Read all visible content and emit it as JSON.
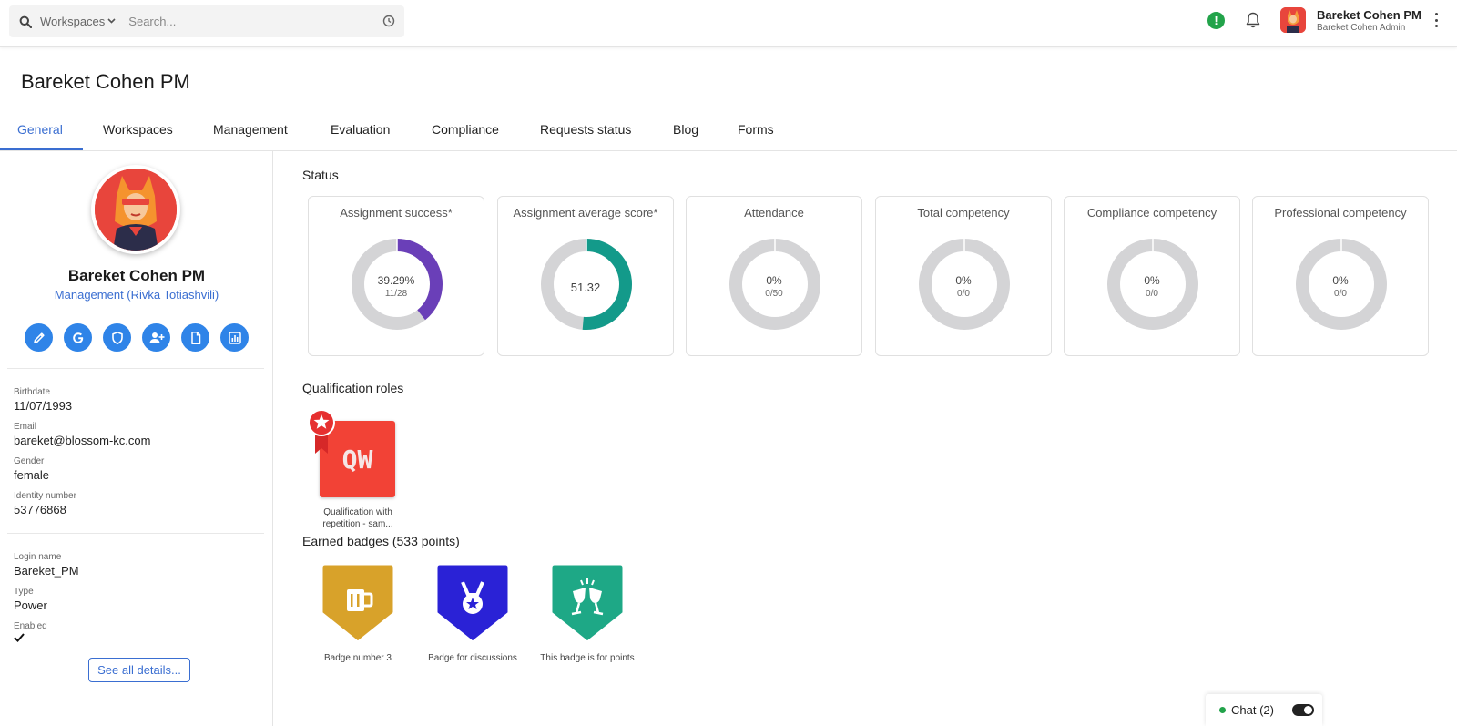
{
  "header": {
    "workspaces_label": "Workspaces",
    "search_placeholder": "Search...",
    "user_name": "Bareket Cohen PM",
    "user_role": "Bareket Cohen Admin",
    "alert_glyph": "!"
  },
  "page": {
    "title": "Bareket Cohen PM"
  },
  "tabs": [
    {
      "label": "General",
      "active": true
    },
    {
      "label": "Workspaces"
    },
    {
      "label": "Management"
    },
    {
      "label": "Evaluation"
    },
    {
      "label": "Compliance"
    },
    {
      "label": "Requests status"
    },
    {
      "label": "Blog"
    },
    {
      "label": "Forms"
    }
  ],
  "profile": {
    "name": "Bareket Cohen PM",
    "department": "Management (Rivka Totiashvili)",
    "actions": [
      "edit-icon",
      "google-icon",
      "shield-icon",
      "add-user-icon",
      "document-icon",
      "report-chart-icon"
    ],
    "fields": [
      {
        "label": "Birthdate",
        "value": "11/07/1993"
      },
      {
        "label": "Email",
        "value": "bareket@blossom-kc.com"
      },
      {
        "label": "Gender",
        "value": "female"
      },
      {
        "label": "Identity number",
        "value": "53776868"
      },
      {
        "label": "Login name",
        "value": "Bareket_PM"
      },
      {
        "label": "Type",
        "value": "Power"
      },
      {
        "label": "Enabled",
        "value": ""
      }
    ],
    "enabled": true,
    "see_all_label": "See all details..."
  },
  "status": {
    "title": "Status",
    "cards": [
      {
        "title": "Assignment success*",
        "percent": "39.29%",
        "fraction": "11/28",
        "fill": 0.3929,
        "color": "#6a3fb8"
      },
      {
        "title": "Assignment average score*",
        "percent": "51.32",
        "fraction": "",
        "fill": 0.5132,
        "color": "#139a8a"
      },
      {
        "title": "Attendance",
        "percent": "0%",
        "fraction": "0/50",
        "fill": 0,
        "color": "#999999"
      },
      {
        "title": "Total competency",
        "percent": "0%",
        "fraction": "0/0",
        "fill": 0,
        "color": "#999999"
      },
      {
        "title": "Compliance competency",
        "percent": "0%",
        "fraction": "0/0",
        "fill": 0,
        "color": "#999999"
      },
      {
        "title": "Professional competency",
        "percent": "0%",
        "fraction": "0/0",
        "fill": 0,
        "color": "#999999"
      }
    ]
  },
  "qualification": {
    "title": "Qualification roles",
    "items": [
      {
        "abbr": "QW",
        "label": "Qualification with repetition - sam...",
        "color": "#f24236"
      }
    ]
  },
  "badges": {
    "title": "Earned badges (533 points)",
    "items": [
      {
        "label": "Badge number 3",
        "color": "#d8a22a",
        "icon": "beer-mug-icon"
      },
      {
        "label": "Badge for discussions",
        "color": "#2a22d6",
        "icon": "medal-icon"
      },
      {
        "label": "This badge is for points",
        "color": "#1ea886",
        "icon": "cheers-glasses-icon"
      }
    ]
  },
  "chat": {
    "label": "Chat (2)"
  }
}
